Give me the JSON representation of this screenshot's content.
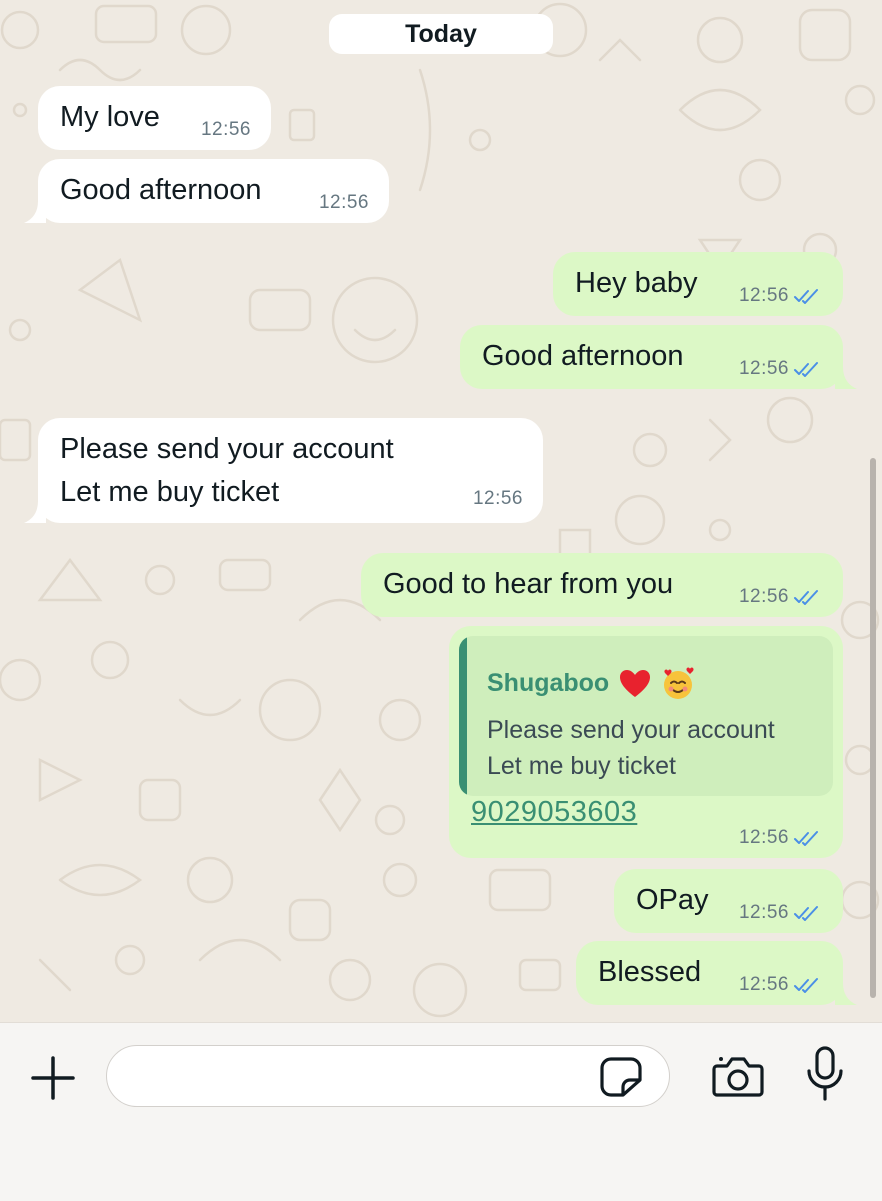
{
  "chat": {
    "day_label": "Today",
    "messages": [
      {
        "dir": "in",
        "text": "My love",
        "time": "12:56"
      },
      {
        "dir": "in",
        "text": "Good afternoon",
        "time": "12:56"
      },
      {
        "dir": "out",
        "text": "Hey baby",
        "time": "12:56"
      },
      {
        "dir": "out",
        "text": "Good afternoon",
        "time": "12:56"
      },
      {
        "dir": "in",
        "text": "Please send your account\nLet me buy ticket",
        "time": "12:56"
      },
      {
        "dir": "out",
        "text": "Good to hear from you",
        "time": "12:56"
      },
      {
        "dir": "out",
        "reply": {
          "name": "Shugaboo",
          "text": "Please send your account\nLet me buy ticket"
        },
        "link": "9029053603",
        "time": "12:56"
      },
      {
        "dir": "out",
        "text": "OPay",
        "time": "12:56"
      },
      {
        "dir": "out",
        "text": "Blessed",
        "time": "12:56"
      }
    ]
  },
  "footer": {
    "input_placeholder": "",
    "icons": [
      "plus-icon",
      "sticker-icon",
      "camera-icon",
      "microphone-icon"
    ]
  },
  "colors": {
    "background": "#efeae2",
    "incoming": "#ffffff",
    "outgoing": "#dcf8c6",
    "accent": "#3a8f73",
    "read_ticks": "#4a8fe7"
  }
}
